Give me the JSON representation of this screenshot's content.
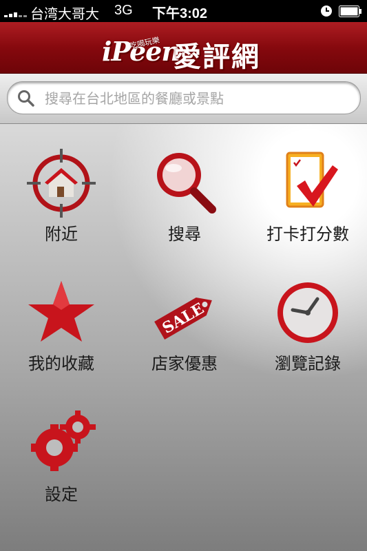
{
  "status_bar": {
    "carrier": "台湾大哥大",
    "network": "3G",
    "time": "下午3:02"
  },
  "header": {
    "logo_latin": "iPeen",
    "logo_sub": "吃喝玩樂",
    "logo_chinese": "愛評網"
  },
  "search": {
    "placeholder": "搜尋在台北地區的餐廳或景點"
  },
  "menu": {
    "items": [
      {
        "label": "附近",
        "icon": "nearby-target-house-icon"
      },
      {
        "label": "搜尋",
        "icon": "magnifier-icon"
      },
      {
        "label": "打卡打分數",
        "icon": "checkin-rating-icon"
      },
      {
        "label": "我的收藏",
        "icon": "star-icon"
      },
      {
        "label": "店家優惠",
        "icon": "sale-tag-icon"
      },
      {
        "label": "瀏覽記錄",
        "icon": "clock-icon"
      },
      {
        "label": "設定",
        "icon": "gears-icon"
      }
    ]
  },
  "colors": {
    "brand_red": "#9c1016",
    "icon_red": "#c8141c"
  }
}
